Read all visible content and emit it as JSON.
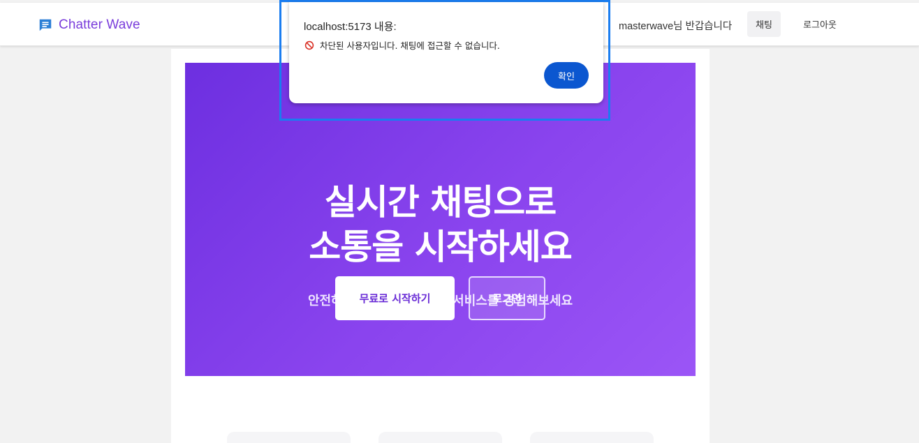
{
  "navbar": {
    "brand": "Chatter Wave",
    "brand_icon": "chat-bubble-icon",
    "greeting": "masterwave님 반갑습니다",
    "chat_label": "채팅",
    "logout_label": "로그아웃"
  },
  "hero": {
    "title_line1": "실시간 채팅으로",
    "title_line2": "소통을 시작하세요",
    "subtitle": "안전하고 빠른 실시간 채팅 서비스를 경험해보세요",
    "start_label": "무료로 시작하기",
    "login_label": "로그인"
  },
  "dialog": {
    "title": "localhost:5173 내용:",
    "message": "차단된 사용자입니다. 채팅에 접근할 수 없습니다.",
    "icon": "blocked-icon",
    "ok_label": "확인"
  },
  "colors": {
    "brand": "#7a3ddb",
    "hero_gradient_start": "#6d2fe0",
    "hero_gradient_end": "#9b55f6",
    "dialog_button": "#0b57d0",
    "focus_outline": "#1a7df0"
  }
}
